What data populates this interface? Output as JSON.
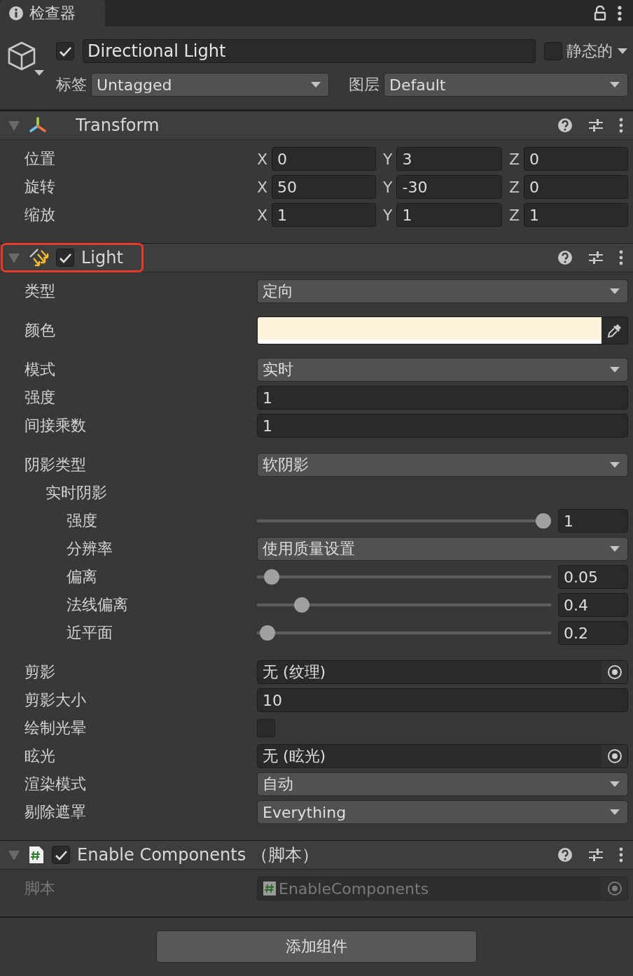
{
  "tab": {
    "label": "检查器"
  },
  "header": {
    "active": true,
    "name": "Directional Light",
    "static": false,
    "static_label": "静态的",
    "tag_label": "标签",
    "tag": "Untagged",
    "layer_label": "图层",
    "layer": "Default"
  },
  "components": [
    {
      "kind": "transform",
      "title": "Transform",
      "expanded": true,
      "properties": [
        {
          "kind": "vector3",
          "label": "位置",
          "values": [
            {
              "axis": "X",
              "value": "0"
            },
            {
              "axis": "Y",
              "value": "3"
            },
            {
              "axis": "Z",
              "value": "0"
            }
          ]
        },
        {
          "kind": "vector3",
          "label": "旋转",
          "values": [
            {
              "axis": "X",
              "value": "50"
            },
            {
              "axis": "Y",
              "value": "-30"
            },
            {
              "axis": "Z",
              "value": "0"
            }
          ]
        },
        {
          "kind": "vector3",
          "label": "缩放",
          "values": [
            {
              "axis": "X",
              "value": "1"
            },
            {
              "axis": "Y",
              "value": "1"
            },
            {
              "axis": "Z",
              "value": "1"
            }
          ]
        }
      ]
    },
    {
      "kind": "light",
      "title": "Light",
      "enabled": true,
      "expanded": true,
      "highlighted": true,
      "properties": [
        {
          "kind": "dropdown",
          "label": "类型",
          "value": "定向"
        },
        {
          "kind": "color",
          "label": "颜色",
          "color": "#fdf3da"
        },
        {
          "kind": "dropdown",
          "label": "模式",
          "value": "实时"
        },
        {
          "kind": "number",
          "label": "强度",
          "value": "1"
        },
        {
          "kind": "number",
          "label": "间接乘数",
          "value": "1"
        },
        {
          "kind": "dropdown",
          "label": "阴影类型",
          "value": "软阴影",
          "gap_before": true,
          "children": [
            {
              "kind": "header",
              "label": "实时阴影",
              "children": [
                {
                  "kind": "slider",
                  "label": "强度",
                  "value": "1",
                  "level": 1
                },
                {
                  "kind": "dropdown",
                  "label": "分辨率",
                  "value": "使用质量设置"
                },
                {
                  "kind": "slider",
                  "label": "偏离",
                  "value": "0.05",
                  "level": 0.025
                },
                {
                  "kind": "slider",
                  "label": "法线偏离",
                  "value": "0.4",
                  "level": 0.133
                },
                {
                  "kind": "slider",
                  "label": "近平面",
                  "value": "0.2",
                  "level": 0.01
                }
              ]
            }
          ]
        },
        {
          "kind": "object",
          "label": "剪影",
          "value": "无 (纹理)",
          "gap_before": true
        },
        {
          "kind": "number",
          "label": "剪影大小",
          "value": "10"
        },
        {
          "kind": "checkbox",
          "label": "绘制光晕",
          "checked": false
        },
        {
          "kind": "object",
          "label": "眩光",
          "value": "无 (眩光)"
        },
        {
          "kind": "dropdown",
          "label": "渲染模式",
          "value": "自动"
        },
        {
          "kind": "dropdown",
          "label": "剔除遮罩",
          "value": "Everything"
        }
      ]
    },
    {
      "kind": "script",
      "title": "Enable Components （脚本）",
      "enabled": true,
      "expanded": true,
      "properties": [
        {
          "kind": "script",
          "label": "脚本",
          "value": "EnableComponents",
          "disabled": true
        }
      ]
    }
  ],
  "add_button": "添加组件"
}
